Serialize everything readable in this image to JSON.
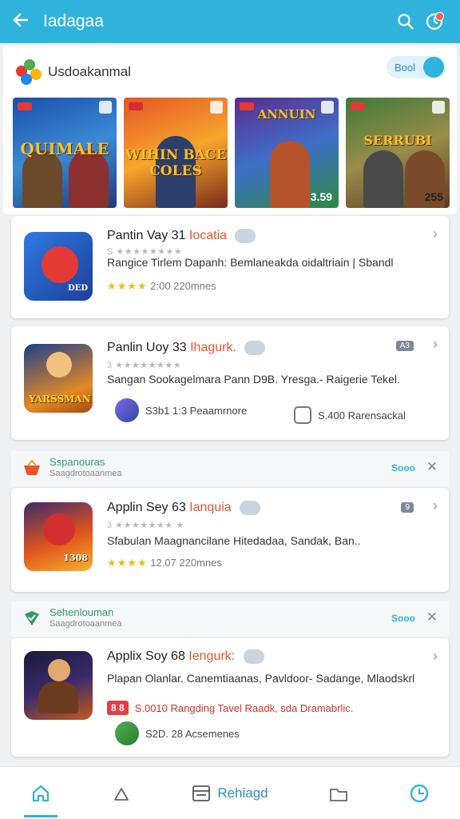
{
  "header": {
    "title": "Iadagaa",
    "back_icon": "arrow-left-icon",
    "search_icon": "search-icon",
    "notify_icon": "notification-icon"
  },
  "brand": {
    "name": "Usdoakanmal",
    "toggle_label": "Bool"
  },
  "covers": [
    {
      "title": "QUIMALE",
      "price": ""
    },
    {
      "title": "WIHIN BACE COLES",
      "price": ""
    },
    {
      "title": "ANNUIN",
      "price": "3.59"
    },
    {
      "title": "SERRUBI",
      "price": "255"
    }
  ],
  "apps": [
    {
      "title": "Pantin Vay 31",
      "highlight": "Iocatia",
      "meta": "S ★★★★★★★★",
      "desc": "Rangice Tirlem Dapanh: Bemlaneakda oidaltriain | Sbandl",
      "rating_stars": "★★★★",
      "rating_text": "2:00 220mnes",
      "thumb_label": "DED"
    },
    {
      "title": "Panlin Uoy 33",
      "highlight": "Ihagurk.",
      "meta": "3 ★★★★★★★★",
      "desc": "Sangan Sookagelmara Pann D9B. Yresga.- Raigerie Tekel.",
      "mini": "A3",
      "row_left": "S3b1 1:3 Peaamrnore",
      "row_right": "S.400 Rarensackal",
      "thumb_label": "YARSSMAN"
    },
    {
      "title": "Applin Sey 63",
      "highlight": "Ianquia",
      "meta": "3 ★★★★★★★ ★",
      "desc": "Sfabulan Maagnancilane Hitedadaa, Sandak, Ban..",
      "mini": "9",
      "rating_stars": "★★★★",
      "rating_text": "12.07 220mnes",
      "thumb_label": "1308"
    },
    {
      "title": "Applix Soy 68",
      "highlight": "Iengurk:",
      "desc": "Plapan Olanlar. Canemtiaanas, Pavldoor- Sadange, Mlaodskrl",
      "red_tag": "8 8",
      "red_text": "S.0010 Rangding Tavel Raadk, sda Dramabrlic.",
      "row_left": "S2D. 28 Acsemenes"
    }
  ],
  "sections": [
    {
      "title": "Sspanouras",
      "subtitle": "Saagdrotoaanmea",
      "action": "Sooo"
    },
    {
      "title": "Sehenlouman",
      "subtitle": "Saagdrotoaanmea",
      "action": "Sooo"
    }
  ],
  "nav": {
    "center_label": "Rehiagd"
  },
  "colors": {
    "primary": "#2fb3dc",
    "accent_orange": "#e8532b",
    "star": "#f5b81c",
    "green": "#2f9a6a"
  }
}
